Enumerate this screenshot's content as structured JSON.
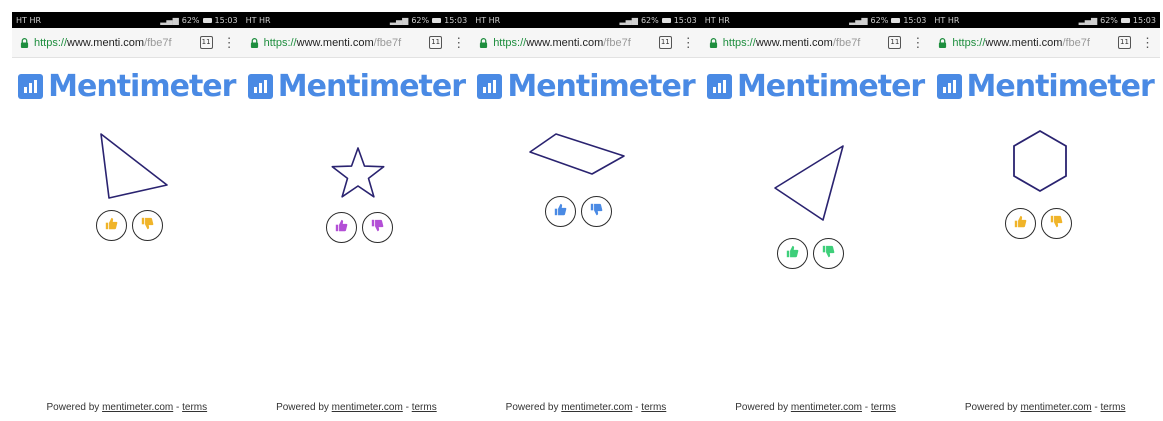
{
  "screens": [
    {
      "status": {
        "carrier": "HT HR",
        "time": "15:03",
        "battery": "62%"
      },
      "url": {
        "scheme": "https://",
        "host": "www.menti.com",
        "path": "/fbe7f"
      },
      "tab_count": "11",
      "logo_text": "Mentimeter",
      "shape": "triangle",
      "reaction_color": "#f0b429",
      "footer": {
        "prefix": "Powered by ",
        "link": "mentimeter.com",
        "sep": " - ",
        "terms": "terms"
      }
    },
    {
      "status": {
        "carrier": "HT HR",
        "time": "15:03",
        "battery": "62%"
      },
      "url": {
        "scheme": "https://",
        "host": "www.menti.com",
        "path": "/fbe7f"
      },
      "tab_count": "11",
      "logo_text": "Mentimeter",
      "shape": "star",
      "reaction_color": "#b34fd6",
      "footer": {
        "prefix": "Powered by ",
        "link": "mentimeter.com",
        "sep": " - ",
        "terms": "terms"
      }
    },
    {
      "status": {
        "carrier": "HT HR",
        "time": "15:03",
        "battery": "62%"
      },
      "url": {
        "scheme": "https://",
        "host": "www.menti.com",
        "path": "/fbe7f"
      },
      "tab_count": "11",
      "logo_text": "Mentimeter",
      "shape": "parallelogram",
      "reaction_color": "#4a8ae4",
      "footer": {
        "prefix": "Powered by ",
        "link": "mentimeter.com",
        "sep": " - ",
        "terms": "terms"
      }
    },
    {
      "status": {
        "carrier": "HT HR",
        "time": "15:03",
        "battery": "62%"
      },
      "url": {
        "scheme": "https://",
        "host": "www.menti.com",
        "path": "/fbe7f"
      },
      "tab_count": "11",
      "logo_text": "Mentimeter",
      "shape": "sliver-triangle",
      "reaction_color": "#3ecf7a",
      "footer": {
        "prefix": "Powered by ",
        "link": "mentimeter.com",
        "sep": " - ",
        "terms": "terms"
      }
    },
    {
      "status": {
        "carrier": "HT HR",
        "time": "15:03",
        "battery": "62%"
      },
      "url": {
        "scheme": "https://",
        "host": "www.menti.com",
        "path": "/fbe7f"
      },
      "tab_count": "11",
      "logo_text": "Mentimeter",
      "shape": "hexagon",
      "reaction_color": "#f0b429",
      "footer": {
        "prefix": "Powered by ",
        "link": "mentimeter.com",
        "sep": " - ",
        "terms": "terms"
      }
    }
  ],
  "icons": {
    "lock": "lock-icon",
    "tabs": "tab-switcher-icon",
    "menu": "overflow-menu-icon",
    "logo": "mentimeter-logo-icon",
    "like": "thumbs-up-icon",
    "dislike": "thumbs-down-icon"
  },
  "colors": {
    "brand": "#4a8ae4",
    "shape_stroke": "#2a2370",
    "url_green": "#1e8e3e"
  }
}
